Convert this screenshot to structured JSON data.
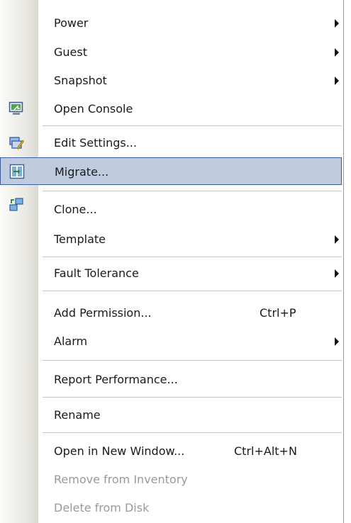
{
  "menu": {
    "items": [
      {
        "label": "Power"
      },
      {
        "label": "Guest"
      },
      {
        "label": "Snapshot"
      },
      {
        "label": "Open Console",
        "icon": "console-icon"
      },
      {
        "label": "Edit Settings...",
        "icon": "edit-settings-icon"
      },
      {
        "label": "Migrate...",
        "icon": "migrate-icon",
        "state": "highlighted"
      },
      {
        "label": "Clone...",
        "icon": "clone-icon"
      },
      {
        "label": "Template"
      },
      {
        "label": "Fault Tolerance"
      },
      {
        "label": "Add Permission...",
        "shortcut": "Ctrl+P"
      },
      {
        "label": "Alarm"
      },
      {
        "label": "Report Performance..."
      },
      {
        "label": "Rename"
      },
      {
        "label": "Open in New Window...",
        "shortcut": "Ctrl+Alt+N"
      },
      {
        "label": "Remove from Inventory",
        "state": "disabled"
      },
      {
        "label": "Delete from Disk",
        "state": "disabled"
      }
    ]
  },
  "colors": {
    "highlight_fill": "#c0cbe0",
    "highlight_border": "#3a5f9f",
    "disabled_text": "#9a9a9a"
  }
}
